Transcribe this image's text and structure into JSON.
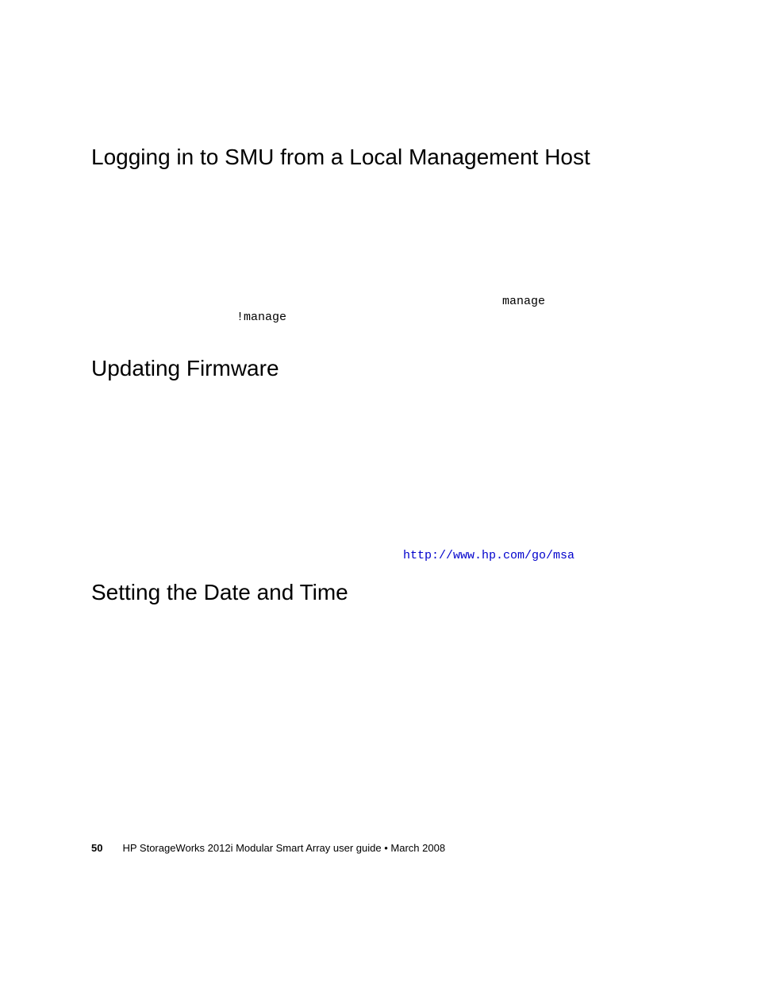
{
  "sections": {
    "s1": {
      "heading": "Logging in to SMU from a Local Management Host",
      "inline_mono_1": "manage",
      "inline_mono_2": "!manage"
    },
    "s2": {
      "heading": "Updating Firmware",
      "link_text": "http://www.hp.com/go/msa"
    },
    "s3": {
      "heading": "Setting the Date and Time"
    }
  },
  "footer": {
    "page_number": "50",
    "doc_title": "HP StorageWorks 2012i Modular Smart Array user guide",
    "separator": "•",
    "date": "March 2008"
  }
}
